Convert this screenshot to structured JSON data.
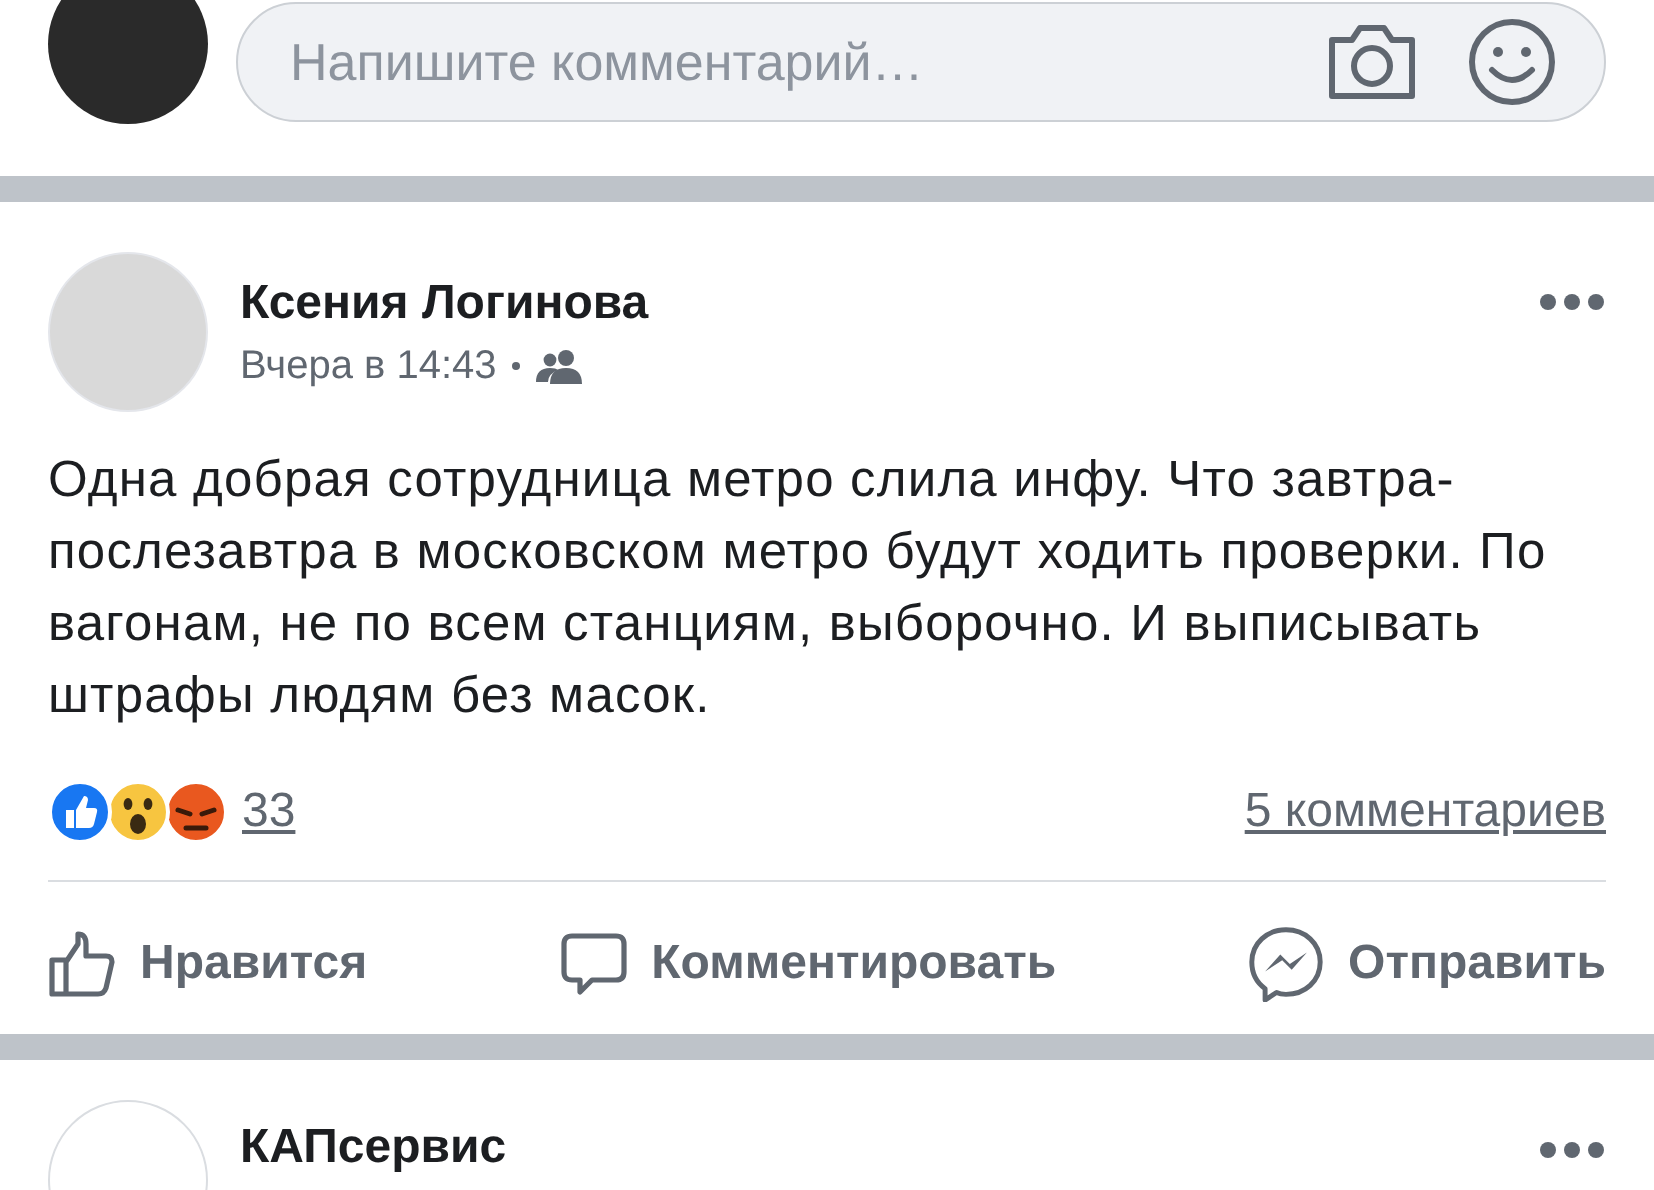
{
  "comment_box": {
    "placeholder": "Напишите комментарий…"
  },
  "post": {
    "author": "Ксения Логинова",
    "time": "Вчера в 14:43",
    "text": "Одна добрая сотрудница метро слила инфу. Что завтра-послезавтра в московском метро будут ходить проверки. По вагонам, не по всем станциям, выборочно. И выписывать штрафы людям без масок.",
    "reactions": [
      {
        "kind": "like"
      },
      {
        "kind": "wow"
      },
      {
        "kind": "angry"
      }
    ],
    "reaction_count": "33",
    "comment_count": "5 комментариев",
    "actions": [
      {
        "kind": "like",
        "label": "Нравится"
      },
      {
        "kind": "comment",
        "label": "Комментировать"
      },
      {
        "kind": "share",
        "label": "Отправить"
      }
    ]
  },
  "next_post": {
    "author": "КАПсервис"
  }
}
